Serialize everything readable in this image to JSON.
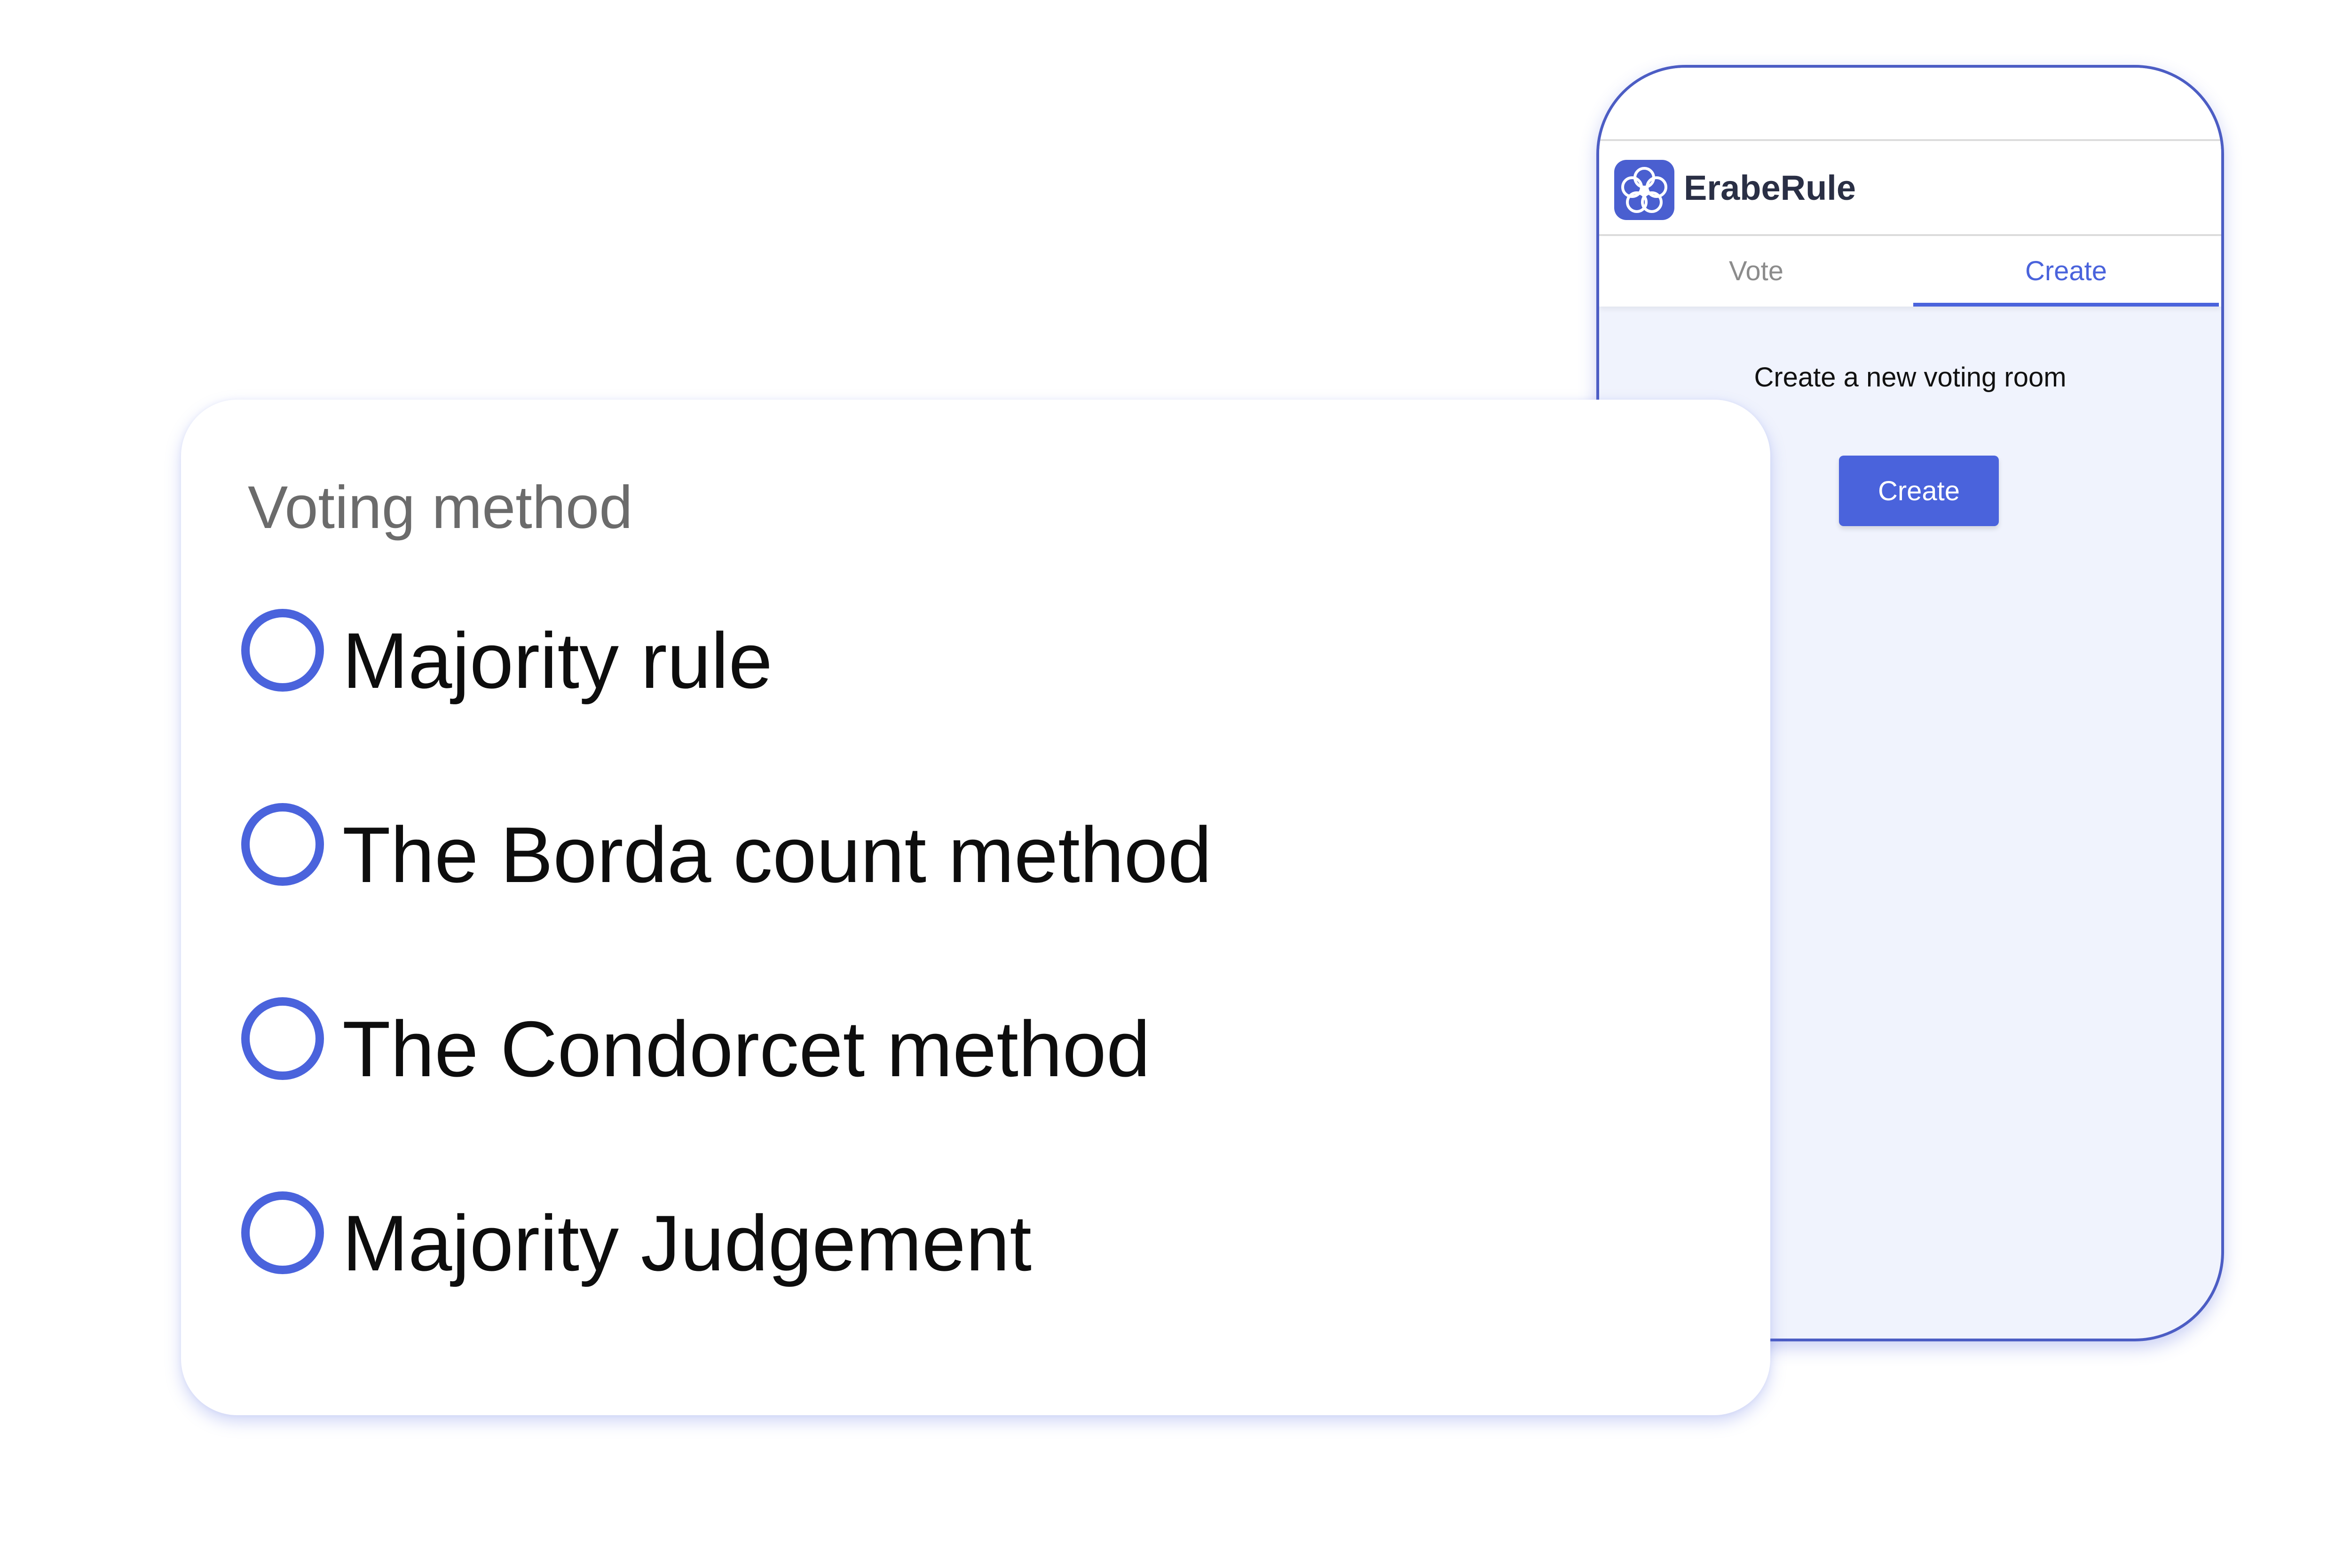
{
  "phone": {
    "app_title": "ErabeRule",
    "logo_icon": "eraberule-flower-logo-icon",
    "tabs": [
      {
        "label": "Vote",
        "active": false
      },
      {
        "label": "Create",
        "active": true
      }
    ],
    "create_heading": "Create a new voting room",
    "create_button_label": "Create"
  },
  "card": {
    "title": "Voting method",
    "options": [
      {
        "label": "Majority rule",
        "selected": false
      },
      {
        "label": "The Borda count method",
        "selected": false
      },
      {
        "label": "The Condorcet method",
        "selected": false
      },
      {
        "label": "Majority Judgement",
        "selected": false
      }
    ]
  },
  "colors": {
    "accent": "#4a63dc",
    "phone_border": "#4c5dc4",
    "phone_background": "#f0f3fd",
    "title_text": "#6b6b6b",
    "inactive_tab": "#8c8c8c"
  }
}
